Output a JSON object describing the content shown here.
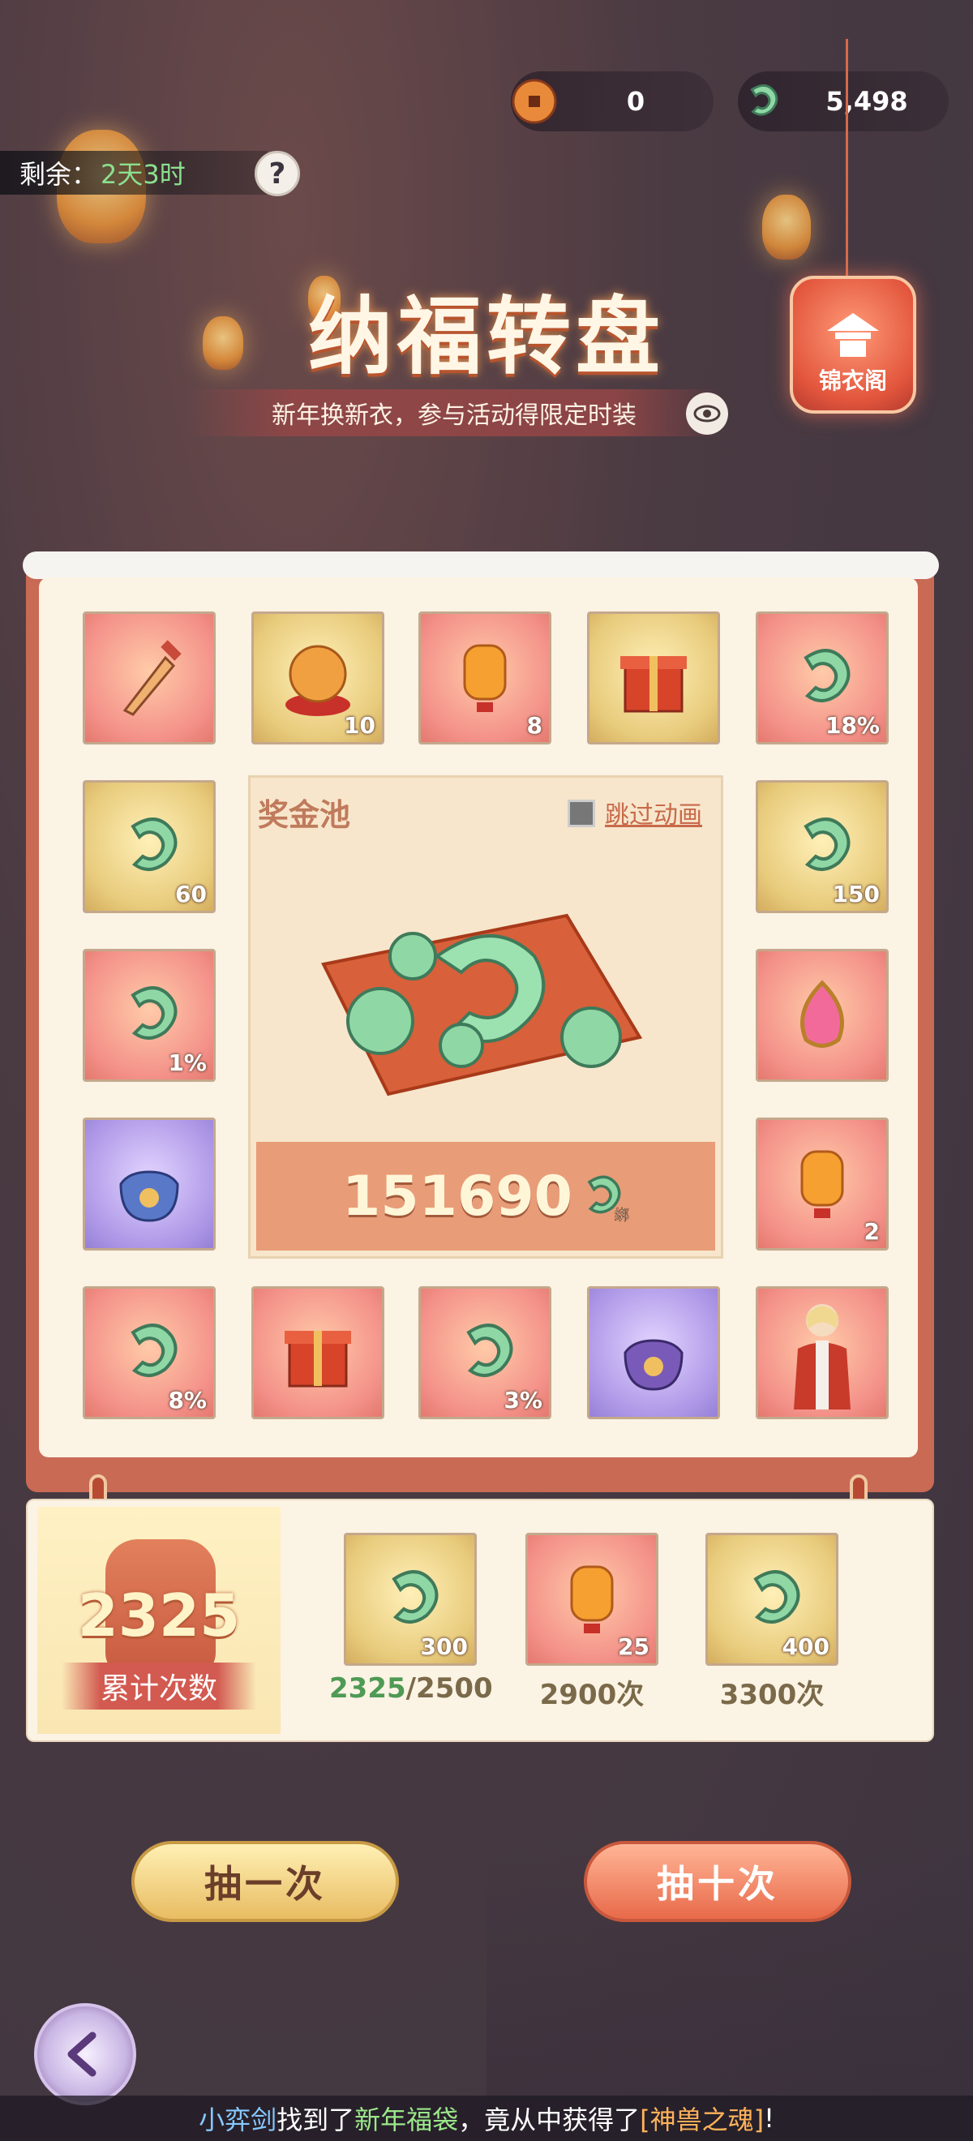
{
  "currency": {
    "coin_value": "0",
    "jade_value": "5,498"
  },
  "timer": {
    "label": "剩余：",
    "value": "2天3时"
  },
  "help_label": "?",
  "event": {
    "title": "纳福转盘",
    "subtitle": "新年换新衣，参与活动得限定时装"
  },
  "wardrobe_label": "锦衣阁",
  "grid": {
    "tiles": [
      {
        "item": "sword",
        "qty": ""
      },
      {
        "item": "crystal-ball",
        "qty": "10"
      },
      {
        "item": "lantern",
        "qty": "8"
      },
      {
        "item": "gift-box",
        "qty": ""
      },
      {
        "item": "jade",
        "qty": "18%"
      },
      {
        "item": "jade",
        "qty": "60"
      },
      {
        "item": "jade",
        "qty": "150"
      },
      {
        "item": "jade",
        "qty": "1%"
      },
      {
        "item": "gem",
        "qty": ""
      },
      {
        "item": "lucky-bag",
        "qty": ""
      },
      {
        "item": "lantern",
        "qty": "2"
      },
      {
        "item": "jade",
        "qty": "8%"
      },
      {
        "item": "gift-box",
        "qty": ""
      },
      {
        "item": "jade",
        "qty": "3%"
      },
      {
        "item": "purple-bag",
        "qty": ""
      },
      {
        "item": "character",
        "qty": ""
      }
    ]
  },
  "pool": {
    "title": "奖金池",
    "skip_label": "跳过动画",
    "amount": "151690",
    "bound_badge": "绑"
  },
  "tracker": {
    "count": "2325",
    "count_label": "累计次数",
    "rewards": [
      {
        "qty": "300",
        "progress_done": "2325",
        "progress_rest": "/2500"
      },
      {
        "qty": "25",
        "progress_done": "",
        "progress_rest": "2900次"
      },
      {
        "qty": "400",
        "progress_done": "",
        "progress_rest": "3300次"
      }
    ]
  },
  "buttons": {
    "draw_one": "抽一次",
    "draw_ten": "抽十次"
  },
  "ticker": {
    "player": "小弈剑",
    "text1": "找到了",
    "item": "新年福袋",
    "text2": "，竟从中获得了",
    "prize": "[神兽之魂]",
    "text3": "!"
  },
  "colors": {
    "accent_green": "#8be08e",
    "board_red": "#c96a55",
    "panel_cream": "#fbf3e4"
  }
}
